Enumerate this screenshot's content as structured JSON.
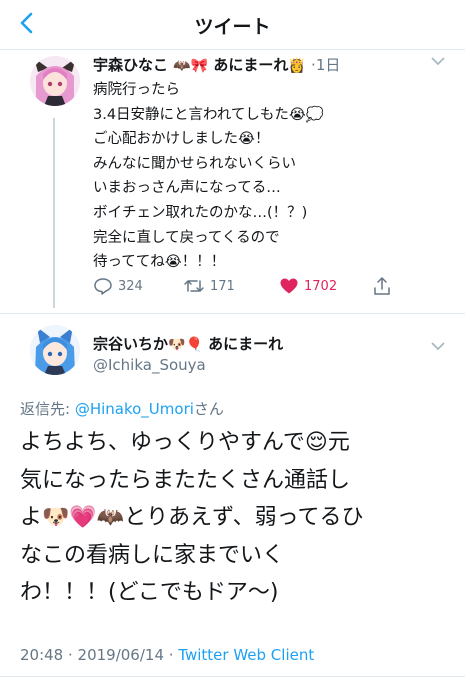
{
  "header": {
    "title": "ツイート"
  },
  "original_tweet": {
    "display_name": "宇森ひなこ",
    "name_suffix": "あにまーれ",
    "time": "1日",
    "lines": [
      "病院行ったら",
      "3.4日安静にと言われてしもた😭💭",
      "ご心配おかけしました😭！",
      "みんなに聞かせられないくらい",
      "いまおっさん声になってる…",
      "ボイチェン取れたのかな…(！？)",
      "完全に直して戻ってくるので",
      "待っててね😭！！！"
    ],
    "replies": "324",
    "retweets": "171",
    "likes": "1702",
    "colors": {
      "like": "#e0245e",
      "accent": "#1da1f2"
    }
  },
  "main_tweet": {
    "display_name": "宗谷いちか",
    "name_suffix": "あにまーれ",
    "handle": "@Ichika_Souya",
    "reply_prefix": "返信先: ",
    "reply_mention": "@Hinako_Umori",
    "reply_suffix": "さん",
    "lines": [
      "よちよち、ゆっくりやすんで😌元",
      "気になったらまたたくさん通話し",
      "よ🐶💗🦇とりあえず、弱ってるひ",
      "なこの看病しに家までいく",
      "わ！！！(どこでもドア〜)"
    ],
    "time": "20:48 · 2019/06/14 · ",
    "client": "Twitter Web Client"
  }
}
